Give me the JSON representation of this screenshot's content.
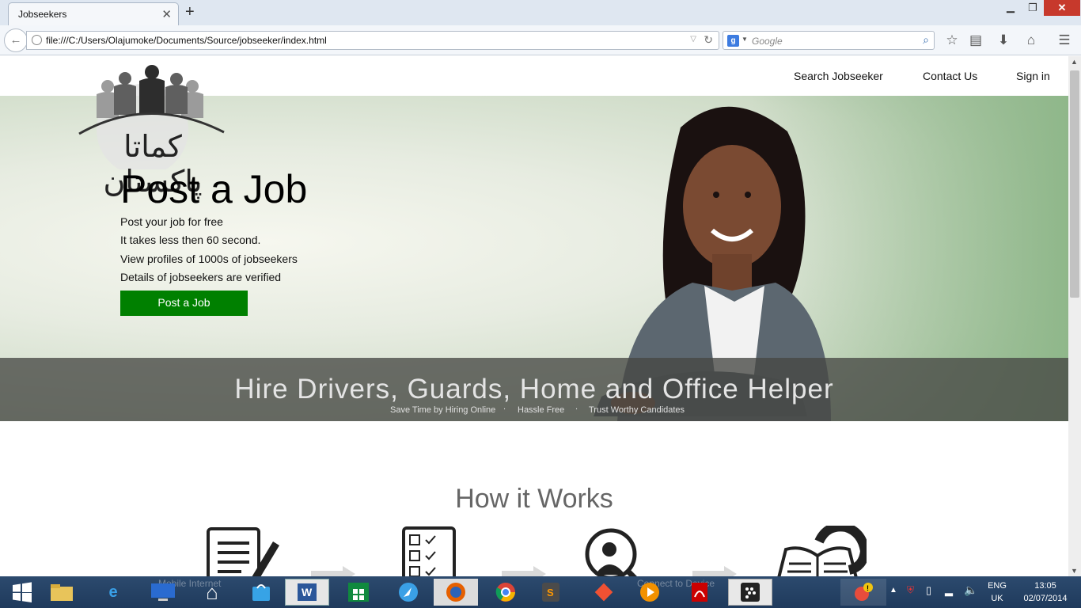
{
  "browser": {
    "tab_title": "Jobseekers",
    "tab_close": "✕",
    "new_tab": "+",
    "url": "file:///C:/Users/Olajumoke/Documents/Source/jobseeker/index.html",
    "search_engine_badge": "g",
    "search_placeholder": "Google",
    "window_buttons": {
      "minimize": "▁",
      "maximize": "❐",
      "close": "✕"
    },
    "icons": [
      "back-arrow-icon",
      "globe-icon",
      "reload-icon",
      "search-icon",
      "bookmark-star-icon",
      "reading-list-icon",
      "download-icon",
      "home-icon",
      "menu-icon"
    ]
  },
  "site": {
    "nav": {
      "search": "Search Jobseeker",
      "contact": "Contact Us",
      "signin": "Sign in"
    },
    "logo_text": "کماتا پاکستان",
    "hero": {
      "title": "Post a Job",
      "lines": [
        "Post your job for free",
        "It takes less then 60 second.",
        "View profiles of 1000s of jobseekers",
        "Details of jobseekers are verified"
      ],
      "button": "Post a Job"
    },
    "hire": {
      "title": "Hire Drivers, Guards, Home and Office Helper",
      "points": [
        "Save Time by Hiring Online",
        "Hassle Free",
        "Trust Worthy Candidates"
      ],
      "separator": "."
    },
    "how_it_works": {
      "title": "How it Works",
      "steps": [
        "form-edit-icon",
        "checklist-icon",
        "profile-search-icon",
        "phone-book-icon"
      ]
    },
    "colors": {
      "accent_green": "#008000",
      "logo_green": "#1e8a1e"
    }
  },
  "taskbar": {
    "ghost_text_left": "Mobile Internet",
    "ghost_text_right": "Connect to Device",
    "apps": [
      "start-icon",
      "file-explorer-icon",
      "internet-explorer-icon",
      "lenovo-icon",
      "home-icon",
      "store-bag-icon",
      "word-icon",
      "windows-store-icon",
      "safari-icon",
      "firefox-icon",
      "chrome-icon",
      "sublime-text-icon",
      "git-icon",
      "media-player-icon",
      "acrobat-icon",
      "blackberry-icon"
    ],
    "tray": {
      "lang_top": "ENG",
      "lang_bottom": "UK",
      "time": "13:05",
      "date": "02/07/2014"
    }
  }
}
